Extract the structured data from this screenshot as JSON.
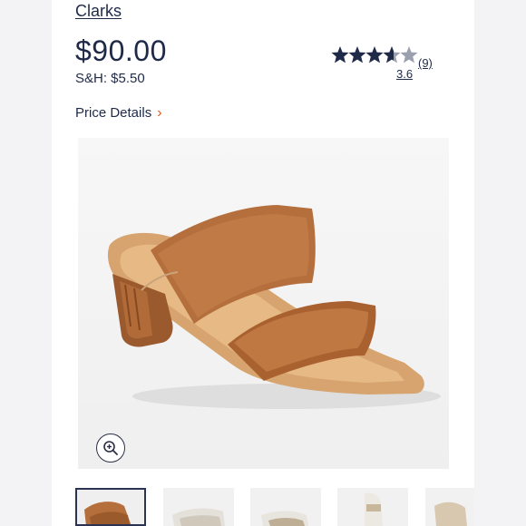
{
  "product": {
    "brand": "Clarks",
    "price": "$90.00",
    "shipping": "S&H: $5.50"
  },
  "rating": {
    "value": 3.6,
    "value_text": "3.6",
    "review_count_text": "(9)",
    "max": 5
  },
  "price_details": {
    "label": "Price Details",
    "chevron": "›"
  },
  "colors": {
    "accent": "#e05a1c",
    "text": "#1f2a48",
    "star_filled": "#1f2a48",
    "star_empty": "#9aa0ad",
    "leather": "#b46f3d"
  },
  "icons": {
    "zoom": "zoom-in-icon",
    "chevron": "chevron-right-icon",
    "star": "star-icon"
  },
  "gallery": {
    "thumbnails": [
      "tan-sandal",
      "white-sandal",
      "white-sandal",
      "white-sandal",
      "tan-sandal"
    ],
    "selected_index": 0
  }
}
